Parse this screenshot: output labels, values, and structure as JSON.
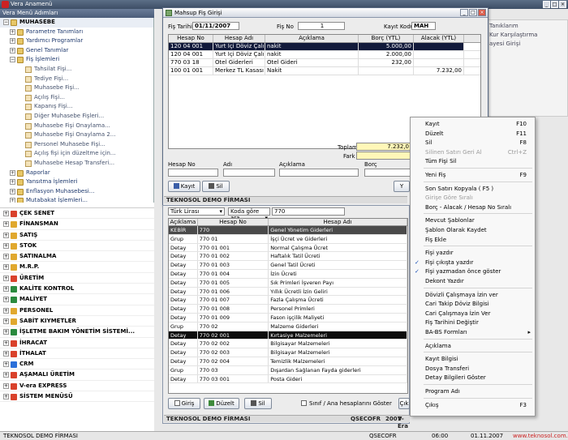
{
  "app": {
    "title": "Vera Anamenü"
  },
  "menu_panel": {
    "caption": "Vera Menü Adımları"
  },
  "tree": [
    {
      "label": "MUHASEBE",
      "level": 0
    },
    {
      "label": "Parametre Tanımları",
      "level": 1
    },
    {
      "label": "Yardımcı Programlar",
      "level": 1
    },
    {
      "label": "Genel Tanımlar",
      "level": 1
    },
    {
      "label": "Fiş İşlemleri",
      "level": 1
    },
    {
      "label": "Tahsilat Fişi...",
      "level": 2
    },
    {
      "label": "Tediye Fişi...",
      "level": 2
    },
    {
      "label": "Muhasebe Fişi...",
      "level": 2
    },
    {
      "label": "Açılış Fişi...",
      "level": 2
    },
    {
      "label": "Kapanış Fişi...",
      "level": 2
    },
    {
      "label": "Diğer Muhasebe Fişleri...",
      "level": 2
    },
    {
      "label": "Muhasebe Fişi Onaylama...",
      "level": 2
    },
    {
      "label": "Muhasebe Fişi Onaylama 2...",
      "level": 2
    },
    {
      "label": "Personel Muhasebe Fişi...",
      "level": 2
    },
    {
      "label": "Açılış fişi için düzeltme için...",
      "level": 2
    },
    {
      "label": "Muhasebe Hesap Transferi...",
      "level": 2
    },
    {
      "label": "Raporlar",
      "level": 1
    },
    {
      "label": "Yansıtma İşlemleri",
      "level": 1
    },
    {
      "label": "Enflasyon Muhasebesi...",
      "level": 1
    },
    {
      "label": "Mutabakat İşlemleri...",
      "level": 1
    }
  ],
  "modules": [
    {
      "label": "ÇEK SENET",
      "color": "#d9412b"
    },
    {
      "label": "FİNANSMAN",
      "color": "#e0a82e"
    },
    {
      "label": "SATIŞ",
      "color": "#e0a82e"
    },
    {
      "label": "STOK",
      "color": "#e0a82e"
    },
    {
      "label": "SATINALMA",
      "color": "#e0a82e"
    },
    {
      "label": "M.R.P.",
      "color": "#e0a82e"
    },
    {
      "label": "ÜRETİM",
      "color": "#d9412b"
    },
    {
      "label": "KALİTE KONTROL",
      "color": "#2b8a3e"
    },
    {
      "label": "MALİYET",
      "color": "#2b8a3e"
    },
    {
      "label": "PERSONEL",
      "color": "#e0a82e"
    },
    {
      "label": "SABİT KIYMETLER",
      "color": "#e0a82e"
    },
    {
      "label": "İŞLETME BAKIM YÖNETİM SİSTEMİ...",
      "color": "#2b8a3e"
    },
    {
      "label": "İHRACAT",
      "color": "#d9412b"
    },
    {
      "label": "İTHALAT",
      "color": "#d9412b"
    },
    {
      "label": "CRM",
      "color": "#2b6fd9"
    },
    {
      "label": "AŞAMALI ÜRETİM",
      "color": "#d9412b"
    },
    {
      "label": "V-era EXPRESS",
      "color": "#d9412b"
    },
    {
      "label": "SİSTEM MENÜSÜ",
      "color": "#d9412b"
    }
  ],
  "backdrop": {
    "items": [
      "Tanıklarım",
      "Kur Karşılaştırma",
      "ayesi Girişi"
    ]
  },
  "dialog": {
    "title": "Mahsup Fiş Girişi",
    "fis_tarihi_label": "Fiş Tarihi",
    "fis_tarihi_value": "01/11/2007",
    "fis_no_label": "Fiş No",
    "fis_no_value": "1",
    "kayit_kodu_label": "Kayıt Kodu",
    "kayit_kodu_value": "MAH",
    "columns": [
      "Hesap No",
      "Hesap Adı",
      "Açıklama",
      "Borç (YTL)",
      "Alacak (YTL)"
    ],
    "rows": [
      {
        "hesap_no": "120 04 001",
        "hesap_adi": "Yurt İçi Döviz Çalışan",
        "aciklama": "nakit",
        "borc": "5.000,00",
        "alacak": ""
      },
      {
        "hesap_no": "120 04 001",
        "hesap_adi": "Yurt İçi Döviz Çalışan",
        "aciklama": "nakit",
        "borc": "2.000,00",
        "alacak": ""
      },
      {
        "hesap_no": "770 03 18",
        "hesap_adi": "Otel Giderleri",
        "aciklama": "Otel Gideri",
        "borc": "232,00",
        "alacak": ""
      },
      {
        "hesap_no": "100 01 001",
        "hesap_adi": "Merkez TL Kasası",
        "aciklama": "Nakit",
        "borc": "",
        "alacak": "7.232,00"
      }
    ],
    "toplam_label": "Toplam",
    "toplam_value": "7.232,0",
    "fark_label": "Fark",
    "hesap_no_label": "Hesap No",
    "adi_label": "Adı",
    "aciklama_label": "Açıklama",
    "borc_label": "Borç",
    "kayit_button": "Kayıt",
    "sil_button": "Sil",
    "cut_button": "Y",
    "company": "TEKNOSOL DEMO FİRMASI"
  },
  "lookup": {
    "currency_select": "Türk Lirası",
    "sort_select": "Koda göre ara",
    "search_value": "770",
    "columns": [
      "Açıklama",
      "Hesap No",
      "Hesap Adı"
    ],
    "rows": [
      {
        "type": "KEBİR",
        "no": "770",
        "name": "Genel Yönetim Giderleri"
      },
      {
        "type": "Grup",
        "no": "770 01",
        "name": "İşçi Ücret ve Giderleri"
      },
      {
        "type": "Detay",
        "no": "770 01 001",
        "name": "Normal Çalışma Ücret"
      },
      {
        "type": "Detay",
        "no": "770 01 002",
        "name": "Haftalık Tatil Ücreti"
      },
      {
        "type": "Detay",
        "no": "770 01 003",
        "name": "Genel Tatil Ücreti"
      },
      {
        "type": "Detay",
        "no": "770 01 004",
        "name": "İzin Ücreti"
      },
      {
        "type": "Detay",
        "no": "770 01 005",
        "name": "Sık Primleri İşveren Payı"
      },
      {
        "type": "Detay",
        "no": "770 01 006",
        "name": "Yıllık Ücretli İzin Geliri"
      },
      {
        "type": "Detay",
        "no": "770 01 007",
        "name": "Fazla Çalışma Ücreti"
      },
      {
        "type": "Detay",
        "no": "770 01 008",
        "name": "Personel Primleri"
      },
      {
        "type": "Detay",
        "no": "770 01 009",
        "name": "Fason işçilik Maliyeti"
      },
      {
        "type": "Grup",
        "no": "770 02",
        "name": "Malzeme Giderleri"
      },
      {
        "type": "Detay",
        "no": "770 02 001",
        "name": "Kırtasiye Malzemeleri"
      },
      {
        "type": "Detay",
        "no": "770 02 002",
        "name": "Bilgisayar Malzemeleri"
      },
      {
        "type": "Detay",
        "no": "770 02 003",
        "name": "Bilgisayar Malzemeleri"
      },
      {
        "type": "Detay",
        "no": "770 02 004",
        "name": "Temizlik Malzemeleri"
      },
      {
        "type": "Grup",
        "no": "770 03",
        "name": "Dışardan Sağlanan Fayda giderleri"
      },
      {
        "type": "Detay",
        "no": "770 03 001",
        "name": "Posta Gideri"
      }
    ],
    "giris_button": "Giriş",
    "duzelt_button": "Düzelt",
    "sil_button": "Sil",
    "checkbox_label": "Sınıf / Ana hesaplarını Göster",
    "cik_button": "Çık",
    "company": "TEKNOSOL DEMO FİRMASI",
    "user": "QSECOFR",
    "year": "2007",
    "app_name": "V-Era"
  },
  "context_menu": [
    {
      "label": "Kayıt",
      "shortcut": "F10"
    },
    {
      "label": "Düzelt",
      "shortcut": "F11"
    },
    {
      "label": "Sil",
      "shortcut": "F8"
    },
    {
      "label": "Silinen Satırı Geri Al",
      "shortcut": "Ctrl+Z",
      "disabled": true
    },
    {
      "label": "Tüm Fişi Sil",
      "shortcut": ""
    },
    {
      "sep": true
    },
    {
      "label": "Yeni Fiş",
      "shortcut": "F9"
    },
    {
      "sep": true
    },
    {
      "label": "Son Satırı Kopyala ( F5 )",
      "shortcut": ""
    },
    {
      "label": "Girişe Göre Sıralı",
      "shortcut": "",
      "disabled": true
    },
    {
      "label": "Borç - Alacak / Hesap No Sıralı",
      "shortcut": ""
    },
    {
      "sep": true
    },
    {
      "label": "Mevcut Şablonlar",
      "shortcut": ""
    },
    {
      "label": "Şablon Olarak Kaydet",
      "shortcut": ""
    },
    {
      "label": "Fiş Ekle",
      "shortcut": ""
    },
    {
      "sep": true
    },
    {
      "label": "Fişi yazdır",
      "shortcut": ""
    },
    {
      "label": "Fişi çıkışta yazdır",
      "shortcut": "",
      "checked": true
    },
    {
      "label": "Fişi yazmadan önce göster",
      "shortcut": "",
      "checked": true
    },
    {
      "label": "Dekont Yazdır",
      "shortcut": ""
    },
    {
      "sep": true
    },
    {
      "label": "Dövizli Çalışmaya İzin ver",
      "shortcut": ""
    },
    {
      "label": "Cari Takip Döviz Bilgisi",
      "shortcut": ""
    },
    {
      "label": "Cari Çalışmaya İzin Ver",
      "shortcut": ""
    },
    {
      "label": "Fiş Tarihini Değiştir",
      "shortcut": ""
    },
    {
      "label": "BA-BS Formları",
      "shortcut": "",
      "submenu": true
    },
    {
      "sep": true
    },
    {
      "label": "Açıklama",
      "shortcut": ""
    },
    {
      "sep": true
    },
    {
      "label": "Kayıt Bilgisi",
      "shortcut": ""
    },
    {
      "label": "Dosya Transferi",
      "shortcut": ""
    },
    {
      "label": "Detay Bilgileri Göster",
      "shortcut": ""
    },
    {
      "sep": true
    },
    {
      "label": "Program Adı",
      "shortcut": ""
    },
    {
      "sep": true
    },
    {
      "label": "Çıkış",
      "shortcut": "F3"
    }
  ],
  "statusbar": {
    "company": "TEKNOSOL DEMO FİRMASI",
    "user": "QSECOFR",
    "time": "06:00",
    "date": "01.11.2007",
    "url": "www.teknosol.com.tr"
  }
}
